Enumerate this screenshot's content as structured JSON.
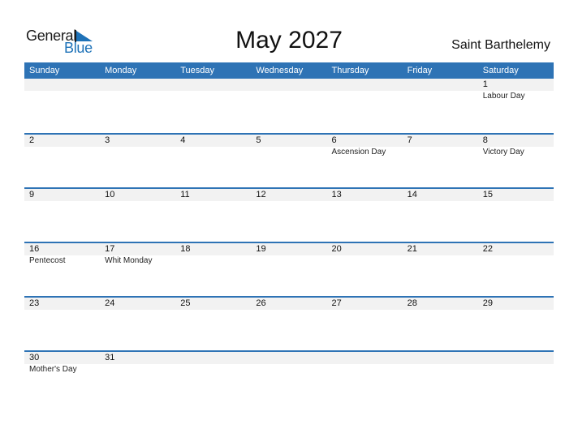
{
  "logo": {
    "line1": "General",
    "line2": "Blue"
  },
  "title": "May 2027",
  "country": "Saint Barthelemy",
  "colors": {
    "accent": "#2e73b5",
    "band": "#f2f2f2"
  },
  "weekdays": [
    "Sunday",
    "Monday",
    "Tuesday",
    "Wednesday",
    "Thursday",
    "Friday",
    "Saturday"
  ],
  "weeks": [
    [
      {
        "d": "",
        "h": ""
      },
      {
        "d": "",
        "h": ""
      },
      {
        "d": "",
        "h": ""
      },
      {
        "d": "",
        "h": ""
      },
      {
        "d": "",
        "h": ""
      },
      {
        "d": "",
        "h": ""
      },
      {
        "d": "1",
        "h": "Labour Day"
      }
    ],
    [
      {
        "d": "2",
        "h": ""
      },
      {
        "d": "3",
        "h": ""
      },
      {
        "d": "4",
        "h": ""
      },
      {
        "d": "5",
        "h": ""
      },
      {
        "d": "6",
        "h": "Ascension Day"
      },
      {
        "d": "7",
        "h": ""
      },
      {
        "d": "8",
        "h": "Victory Day"
      }
    ],
    [
      {
        "d": "9",
        "h": ""
      },
      {
        "d": "10",
        "h": ""
      },
      {
        "d": "11",
        "h": ""
      },
      {
        "d": "12",
        "h": ""
      },
      {
        "d": "13",
        "h": ""
      },
      {
        "d": "14",
        "h": ""
      },
      {
        "d": "15",
        "h": ""
      }
    ],
    [
      {
        "d": "16",
        "h": "Pentecost"
      },
      {
        "d": "17",
        "h": "Whit Monday"
      },
      {
        "d": "18",
        "h": ""
      },
      {
        "d": "19",
        "h": ""
      },
      {
        "d": "20",
        "h": ""
      },
      {
        "d": "21",
        "h": ""
      },
      {
        "d": "22",
        "h": ""
      }
    ],
    [
      {
        "d": "23",
        "h": ""
      },
      {
        "d": "24",
        "h": ""
      },
      {
        "d": "25",
        "h": ""
      },
      {
        "d": "26",
        "h": ""
      },
      {
        "d": "27",
        "h": ""
      },
      {
        "d": "28",
        "h": ""
      },
      {
        "d": "29",
        "h": ""
      }
    ],
    [
      {
        "d": "30",
        "h": "Mother's Day"
      },
      {
        "d": "31",
        "h": ""
      },
      {
        "d": "",
        "h": ""
      },
      {
        "d": "",
        "h": ""
      },
      {
        "d": "",
        "h": ""
      },
      {
        "d": "",
        "h": ""
      },
      {
        "d": "",
        "h": ""
      }
    ]
  ]
}
